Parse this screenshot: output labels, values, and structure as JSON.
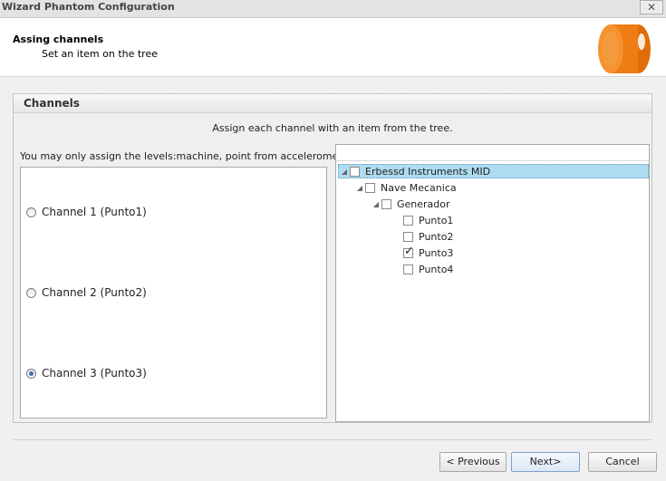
{
  "window": {
    "title": "Wizard Phantom Configuration",
    "close_label": "✕"
  },
  "header": {
    "title": "Assing channels",
    "subtitle": "Set an item on the tree"
  },
  "group": {
    "title": "Channels",
    "instruction": "Assign each channel with an item from the tree.",
    "levels_note": "You may only assign the levels:machine, point from accelerometer"
  },
  "channels": [
    {
      "label": "Channel 1 (Punto1)",
      "selected": false
    },
    {
      "label": "Channel 2 (Punto2)",
      "selected": false
    },
    {
      "label": "Channel 3 (Punto3)",
      "selected": true
    }
  ],
  "tree": [
    {
      "label": "Erbessd Instruments MID",
      "level": 0,
      "expandable": true,
      "checked": false,
      "selected": true
    },
    {
      "label": "Nave Mecanica",
      "level": 1,
      "expandable": true,
      "checked": false,
      "selected": false
    },
    {
      "label": "Generador",
      "level": 2,
      "expandable": true,
      "checked": false,
      "selected": false
    },
    {
      "label": "Punto1",
      "level": 3,
      "expandable": false,
      "checked": false,
      "selected": false
    },
    {
      "label": "Punto2",
      "level": 3,
      "expandable": false,
      "checked": false,
      "selected": false
    },
    {
      "label": "Punto3",
      "level": 3,
      "expandable": false,
      "checked": true,
      "selected": false
    },
    {
      "label": "Punto4",
      "level": 3,
      "expandable": false,
      "checked": false,
      "selected": false
    }
  ],
  "buttons": {
    "previous": "< Previous",
    "next": "Next>",
    "cancel": "Cancel"
  },
  "colors": {
    "logo": "#f07d14",
    "selection": "#aedcf0"
  }
}
